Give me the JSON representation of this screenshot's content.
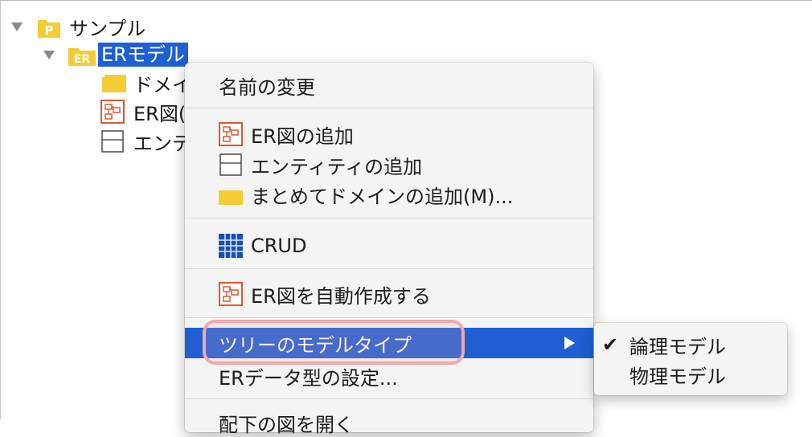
{
  "tree": {
    "root_label": "サンプル",
    "model_label": "ERモデル",
    "child_domain_label": "ドメイ",
    "child_er_label": "ER図(",
    "child_entity_label": "エンテ"
  },
  "context_menu": {
    "rename": "名前の変更",
    "add_er_diagram": "ER図の追加",
    "add_entity": "エンティティの追加",
    "add_domains": "まとめてドメインの追加(M)...",
    "crud": "CRUD",
    "auto_create_er": "ER図を自動作成する",
    "tree_model_type": "ツリーのモデルタイプ",
    "er_datatype_settings": "ERデータ型の設定...",
    "open_diagram_partial": "配下の図を開く"
  },
  "submenu": {
    "logical_model": "論理モデル",
    "physical_model": "物理モデル",
    "checked_item": "logical_model"
  },
  "colors": {
    "selection": "#1f5fd3",
    "highlight_ring": "#f2a9a9",
    "folder_yellow": "#f3cd35",
    "er_red": "#d95a2b"
  }
}
